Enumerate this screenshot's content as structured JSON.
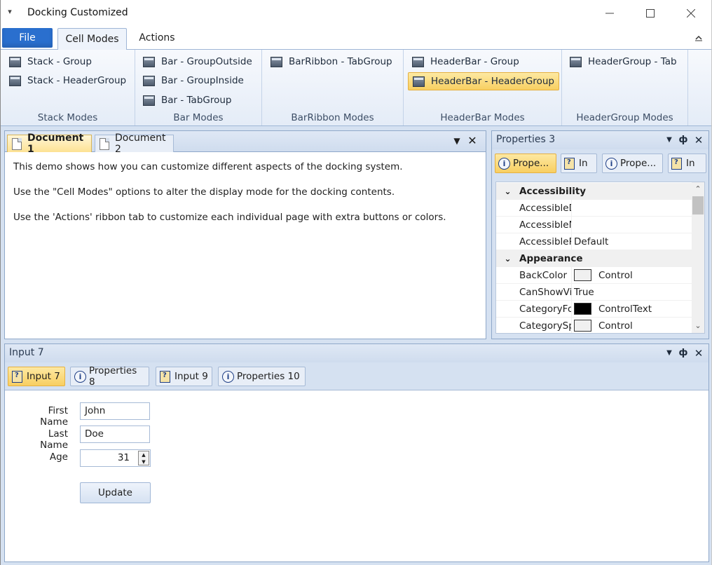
{
  "window": {
    "title": "Docking Customized",
    "qat_icon": "dropdown-arrow-icon",
    "controls": {
      "minimize": "minimize-icon",
      "maximize": "maximize-icon",
      "close": "close-icon"
    }
  },
  "ribbon": {
    "file_label": "File",
    "tabs": [
      {
        "label": "Cell Modes",
        "selected": true
      },
      {
        "label": "Actions",
        "selected": false
      }
    ],
    "groups": [
      {
        "label": "Stack Modes",
        "buttons": [
          "Stack - Group",
          "Stack - HeaderGroup"
        ]
      },
      {
        "label": "Bar Modes",
        "buttons": [
          "Bar - GroupOutside",
          "Bar - GroupInside",
          "Bar - TabGroup"
        ]
      },
      {
        "label": "BarRibbon Modes",
        "buttons": [
          "BarRibbon - TabGroup"
        ]
      },
      {
        "label": "HeaderBar Modes",
        "buttons": [
          "HeaderBar - Group",
          "HeaderBar - HeaderGroup"
        ],
        "selected": "HeaderBar - HeaderGroup"
      },
      {
        "label": "HeaderGroup Modes",
        "buttons": [
          "HeaderGroup - Tab"
        ]
      }
    ]
  },
  "documents": {
    "tabs": [
      {
        "label": "Document 1",
        "selected": true
      },
      {
        "label": "Document 2",
        "selected": false
      }
    ],
    "body": [
      "This demo shows how you can customize different aspects of the docking system.",
      "Use the \"Cell Modes\" options to alter the display mode for the docking contents.",
      "Use the 'Actions' ribbon tab to customize each individual page with extra buttons or colors."
    ]
  },
  "properties": {
    "title": "Properties 3",
    "tabs": [
      {
        "label": "Prope...",
        "icon": "info-icon",
        "selected": true
      },
      {
        "label": "In",
        "icon": "clipboard-icon",
        "selected": false
      },
      {
        "label": "Prope...",
        "icon": "info-icon",
        "selected": false
      },
      {
        "label": "In",
        "icon": "clipboard-icon",
        "selected": false
      }
    ],
    "rows": [
      {
        "type": "category",
        "name": "Accessibility"
      },
      {
        "type": "prop",
        "name": "AccessibleDescr",
        "value": ""
      },
      {
        "type": "prop",
        "name": "AccessibleName",
        "value": ""
      },
      {
        "type": "prop",
        "name": "AccessibleRole",
        "value": "Default"
      },
      {
        "type": "category",
        "name": "Appearance"
      },
      {
        "type": "prop",
        "name": "BackColor",
        "value": "Control",
        "swatch": "#f0f0f0"
      },
      {
        "type": "prop",
        "name": "CanShowVisualS",
        "value": "True"
      },
      {
        "type": "prop",
        "name": "CategoryForeCo",
        "value": "ControlText",
        "swatch": "#000000"
      },
      {
        "type": "prop",
        "name": "CategorySplitter",
        "value": "Control",
        "swatch": "#f0f0f0"
      }
    ]
  },
  "input": {
    "title": "Input 7",
    "tabs": [
      {
        "label": "Input 7",
        "icon": "clipboard-icon",
        "selected": true
      },
      {
        "label": "Properties 8",
        "icon": "info-icon",
        "selected": false
      },
      {
        "label": "Input 9",
        "icon": "clipboard-icon",
        "selected": false
      },
      {
        "label": "Properties 10",
        "icon": "info-icon",
        "selected": false
      }
    ],
    "form": {
      "first_name_label": "First Name",
      "first_name_value": "John",
      "last_name_label": "Last Name",
      "last_name_value": "Doe",
      "age_label": "Age",
      "age_value": "31",
      "update_label": "Update"
    }
  },
  "colors": {
    "selected_highlight": "#f8cf61",
    "file_tab": "#2a6fce",
    "pane_border": "#8fa8c9",
    "background": "#d5e1f1"
  }
}
